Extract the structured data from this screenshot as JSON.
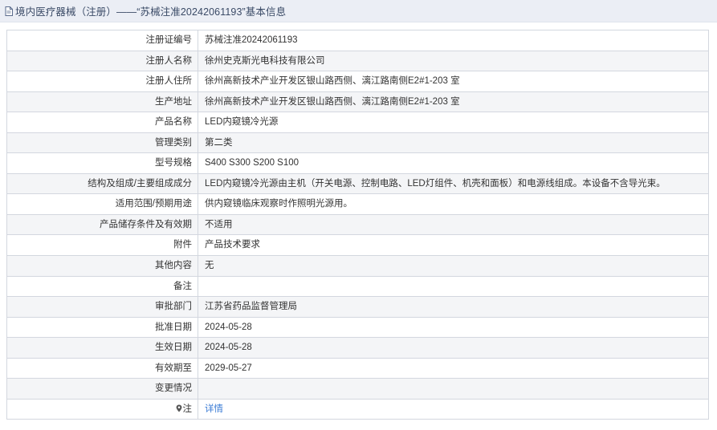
{
  "header": {
    "title": "境内医疗器械（注册）——“苏械注准20242061193”基本信息",
    "icon": "document-icon"
  },
  "rows": [
    {
      "label": "注册证编号",
      "value": "苏械注准20242061193"
    },
    {
      "label": "注册人名称",
      "value": "徐州史克斯光电科技有限公司"
    },
    {
      "label": "注册人住所",
      "value": "徐州高新技术产业开发区银山路西侧、漓江路南侧E2#1-203 室"
    },
    {
      "label": "生产地址",
      "value": "徐州高新技术产业开发区银山路西侧、漓江路南侧E2#1-203 室"
    },
    {
      "label": "产品名称",
      "value": "LED内窥镜冷光源"
    },
    {
      "label": "管理类别",
      "value": "第二类"
    },
    {
      "label": "型号规格",
      "value": "S400 S300 S200 S100"
    },
    {
      "label": "结构及组成/主要组成成分",
      "value": "LED内窥镜冷光源由主机（开关电源、控制电路、LED灯组件、机壳和面板）和电源线组成。本设备不含导光束。"
    },
    {
      "label": "适用范围/预期用途",
      "value": "供内窥镜临床观察时作照明光源用。"
    },
    {
      "label": "产品储存条件及有效期",
      "value": "不适用"
    },
    {
      "label": "附件",
      "value": "产品技术要求"
    },
    {
      "label": "其他内容",
      "value": "无"
    },
    {
      "label": "备注",
      "value": ""
    },
    {
      "label": "审批部门",
      "value": "江苏省药品监督管理局"
    },
    {
      "label": "批准日期",
      "value": "2024-05-28"
    },
    {
      "label": "生效日期",
      "value": "2024-05-28"
    },
    {
      "label": "有效期至",
      "value": "2029-05-27"
    },
    {
      "label": "变更情况",
      "value": ""
    }
  ],
  "footer_row": {
    "label": "注",
    "link_text": "详情",
    "icon": "map-pin-icon"
  },
  "colors": {
    "header_bg": "#ebeef5",
    "stripe_bg": "#f4f5f7",
    "border": "#d3d7df",
    "link": "#3a7bd5"
  }
}
